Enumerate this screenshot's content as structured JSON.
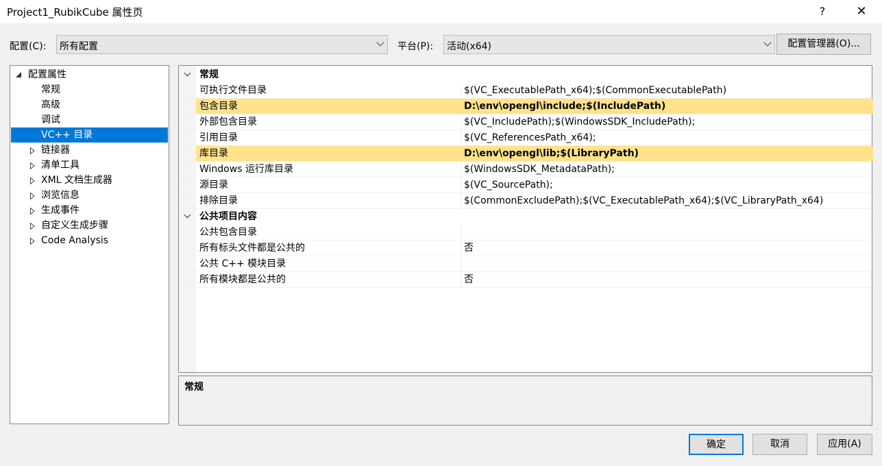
{
  "window": {
    "title": "Project1_RubikCube 属性页",
    "help_label": "?",
    "close_label": "✕"
  },
  "toolbar": {
    "config_label": "配置(C):",
    "config_value": "所有配置",
    "platform_label": "平台(P):",
    "platform_value": "活动(x64)",
    "config_manager_label": "配置管理器(O)..."
  },
  "tree": {
    "root": "配置属性",
    "items": [
      {
        "label": "常规"
      },
      {
        "label": "高级"
      },
      {
        "label": "调试"
      },
      {
        "label": "VC++ 目录"
      },
      {
        "label": "链接器"
      },
      {
        "label": "清单工具"
      },
      {
        "label": "XML 文档生成器"
      },
      {
        "label": "浏览信息"
      },
      {
        "label": "生成事件"
      },
      {
        "label": "自定义生成步骤"
      },
      {
        "label": "Code Analysis"
      }
    ]
  },
  "grid": {
    "categories": [
      {
        "label": "常规",
        "rows": [
          {
            "name": "可执行文件目录",
            "value": "$(VC_ExecutablePath_x64);$(CommonExecutablePath)"
          },
          {
            "name": "包含目录",
            "value": "D:\\env\\opengl\\include;$(IncludePath)"
          },
          {
            "name": "外部包含目录",
            "value": "$(VC_IncludePath);$(WindowsSDK_IncludePath);"
          },
          {
            "name": "引用目录",
            "value": "$(VC_ReferencesPath_x64);"
          },
          {
            "name": "库目录",
            "value": "D:\\env\\opengl\\lib;$(LibraryPath)"
          },
          {
            "name": "Windows 运行库目录",
            "value": "$(WindowsSDK_MetadataPath);"
          },
          {
            "name": "源目录",
            "value": "$(VC_SourcePath);"
          },
          {
            "name": "排除目录",
            "value": "$(CommonExcludePath);$(VC_ExecutablePath_x64);$(VC_LibraryPath_x64)"
          }
        ]
      },
      {
        "label": "公共项目内容",
        "rows": [
          {
            "name": "公共包含目录",
            "value": ""
          },
          {
            "name": "所有标头文件都是公共的",
            "value": "否"
          },
          {
            "name": "公共 C++ 模块目录",
            "value": ""
          },
          {
            "name": "所有模块都是公共的",
            "value": "否"
          }
        ]
      }
    ]
  },
  "description": {
    "text": "常规"
  },
  "buttons": {
    "ok": "确定",
    "cancel": "取消",
    "apply": "应用(A)"
  },
  "colors": {
    "selection": "#0078d7",
    "highlight_row": "#ffe28a"
  }
}
